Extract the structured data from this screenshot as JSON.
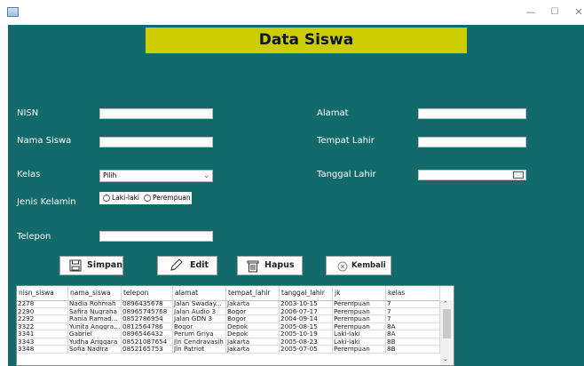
{
  "window": {
    "minimize_glyph": "—",
    "maximize_glyph": "☐",
    "close_glyph": "✕"
  },
  "header": {
    "title": "Data Siswa"
  },
  "form": {
    "nisn_label": "NISN",
    "nama_label": "Nama Siswa",
    "kelas_label": "Kelas",
    "kelas_selected": "Pilih",
    "jk_label": "Jenis Kelamin",
    "jk_options": [
      "Laki-laki",
      "Perempuan"
    ],
    "telepon_label": "Telepon",
    "alamat_label": "Alamat",
    "tempat_label": "Tempat Lahir",
    "tanggal_label": "Tanggal Lahir",
    "nisn_value": "",
    "nama_value": "",
    "telepon_value": "",
    "alamat_value": "",
    "tempat_value": "",
    "tanggal_value": ""
  },
  "buttons": {
    "simpan": "Simpan",
    "edit": "Edit",
    "hapus": "Hapus",
    "kembali": "Kembali"
  },
  "table": {
    "columns": [
      "nisn_siswa",
      "nama_siswa",
      "telepon",
      "alamat",
      "tempat_lahir",
      "tanggal_lahir",
      "jk",
      "kelas"
    ],
    "rows": [
      [
        "2278",
        "Nadia Rohmah",
        "0896435678",
        "Jalan Swaday...",
        "Jakarta",
        "2003-10-15",
        "Perempuan",
        "7"
      ],
      [
        "2290",
        "Safira Nugraha",
        "08965745768",
        "Jalan Audio 3",
        "Bogor",
        "2006-07-17",
        "Perempuan",
        "7"
      ],
      [
        "2292",
        "Rania Ramadhan",
        "0852786954",
        "Jalan GDN 3",
        "Bogor",
        "2004-09-14",
        "Perempuan",
        "7"
      ],
      [
        "3322",
        "Yunita Anggraini",
        "0812564786",
        "Bogor",
        "Depok",
        "2005-08-15",
        "Perempuan",
        "8A"
      ],
      [
        "3341",
        "Gabriel",
        "0896546432",
        "Perum Griya",
        "Depok",
        "2005-10-19",
        "Laki-laki",
        "8A"
      ],
      [
        "3343",
        "Yudha Anggara",
        "08521087654",
        "Jln Cendravasih",
        "Jakarta",
        "2005-08-23",
        "Laki-laki",
        "8B"
      ],
      [
        "3348",
        "Sofia Nadira",
        "0852165753",
        "Jln Patriot",
        "Jakarta",
        "2005-07-05",
        "Perempuan",
        "8B"
      ]
    ]
  },
  "colors": {
    "background": "#136a6a",
    "banner": "#cccc00",
    "title_text": "#0d1140"
  },
  "icons": {
    "simpan": "floppy-disk-icon",
    "edit": "pencil-icon",
    "hapus": "trash-icon",
    "kembali": "circle-x-icon"
  }
}
